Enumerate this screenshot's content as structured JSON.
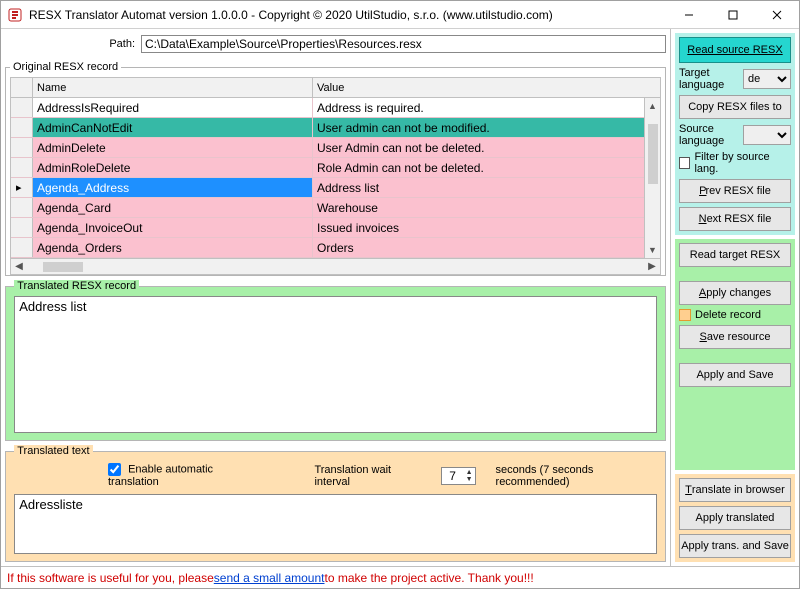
{
  "title": "RESX Translator Automat version 1.0.0.0 - Copyright © 2020 UtilStudio, s.r.o. (www.utilstudio.com)",
  "path": {
    "label": "Path:",
    "value": "C:\\Data\\Example\\Source\\Properties\\Resources.resx"
  },
  "groups": {
    "original": "Original RESX record",
    "translated": "Translated RESX record",
    "translated_text": "Translated text"
  },
  "grid": {
    "columns": {
      "name": "Name",
      "value": "Value"
    },
    "rows": [
      {
        "name": "AddressIsRequired",
        "value": "Address is required.",
        "style": "white"
      },
      {
        "name": "AdminCanNotEdit",
        "value": "User admin can not be modified.",
        "style": "teal"
      },
      {
        "name": "AdminDelete",
        "value": "User Admin can not be deleted.",
        "style": "pink"
      },
      {
        "name": "AdminRoleDelete",
        "value": "Role Admin can not be deleted.",
        "style": "pink"
      },
      {
        "name": "Agenda_Address",
        "value": "Address list",
        "style": "pink",
        "selected": true,
        "marker": true
      },
      {
        "name": "Agenda_Card",
        "value": "Warehouse",
        "style": "pink"
      },
      {
        "name": "Agenda_InvoiceOut",
        "value": "Issued invoices",
        "style": "pink"
      },
      {
        "name": "Agenda_Orders",
        "value": "Orders",
        "style": "pink"
      }
    ]
  },
  "translated_record": "Address list",
  "translated_text_value": "Adressliste",
  "auto_translate": {
    "label": "Enable automatic translation",
    "checked": true
  },
  "wait_interval": {
    "label": "Translation wait interval",
    "value": "7",
    "suffix": "seconds (7 seconds recommended)"
  },
  "right": {
    "read_source": "Read source RESX",
    "target_lang_label": "Target language",
    "target_lang_value": "de",
    "copy_resx": "Copy RESX files to",
    "source_lang_label": "Source language",
    "source_lang_value": "",
    "filter_by_source": "Filter by source lang.",
    "prev_file": "Prev RESX file",
    "next_file": "Next RESX file",
    "read_target": "Read target RESX",
    "apply_changes": "Apply changes",
    "delete_record": "Delete record",
    "save_resource": "Save resource",
    "apply_and_save": "Apply and Save",
    "translate_browser": "Translate in browser",
    "apply_translated": "Apply translated",
    "apply_trans_save": "Apply trans. and Save"
  },
  "footer": {
    "pre": "If this software is useful for you, please ",
    "link": "send a small amount",
    "post": " to make the project active. Thank you!!!"
  }
}
